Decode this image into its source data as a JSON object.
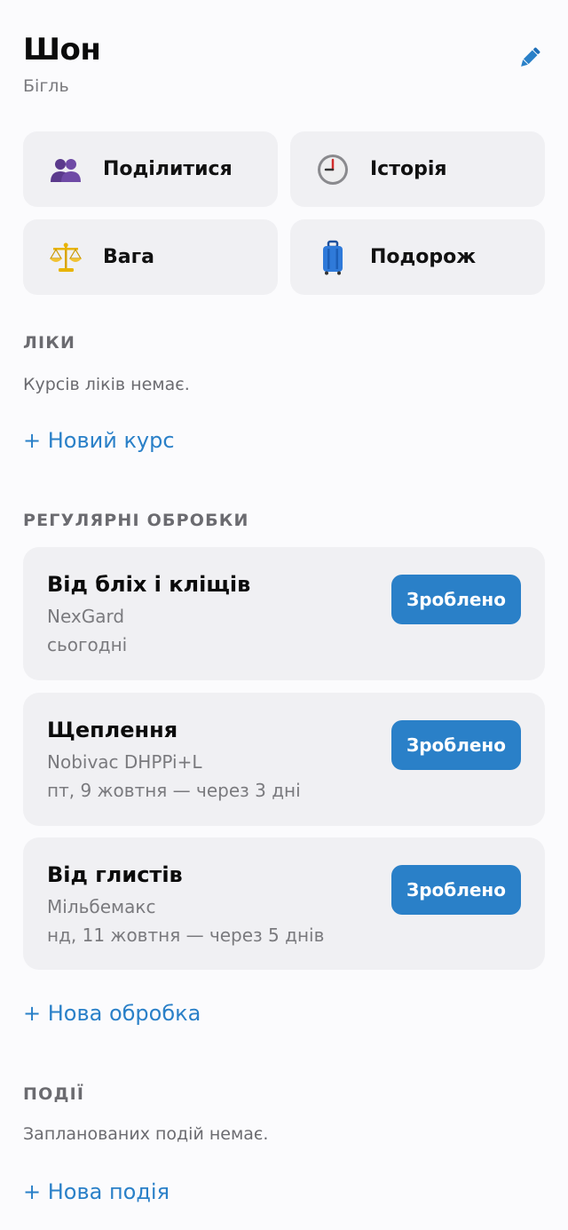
{
  "pet": {
    "name": "Шон",
    "breed": "Бігль"
  },
  "tiles": [
    {
      "label": "Поділитися",
      "icon": "people-icon"
    },
    {
      "label": "Історія",
      "icon": "clock-icon"
    },
    {
      "label": "Вага",
      "icon": "scales-icon"
    },
    {
      "label": "Подорож",
      "icon": "luggage-icon"
    }
  ],
  "medicines": {
    "title": "ЛІКИ",
    "empty": "Курсів ліків немає.",
    "add": "+ Новий курс"
  },
  "treatments": {
    "title": "РЕГУЛЯРНІ ОБРОБКИ",
    "items": [
      {
        "title": "Від бліх і кліщів",
        "product": "NexGard",
        "date": "сьогодні",
        "button": "Зроблено"
      },
      {
        "title": "Щеплення",
        "product": "Nobivac DHPPi+L",
        "date": "пт, 9 жовтня — через 3 дні",
        "button": "Зроблено"
      },
      {
        "title": "Від глистів",
        "product": "Мільбемакс",
        "date": "нд, 11 жовтня — через 5 днів",
        "button": "Зроблено"
      }
    ],
    "add": "+ Нова обробка"
  },
  "events": {
    "title": "ПОДІЇ",
    "empty": "Запланованих подій немає.",
    "add": "+ Нова подія"
  },
  "colors": {
    "accent": "#2a80c8",
    "card": "#f0f0f3",
    "background": "#fbfbfd"
  }
}
